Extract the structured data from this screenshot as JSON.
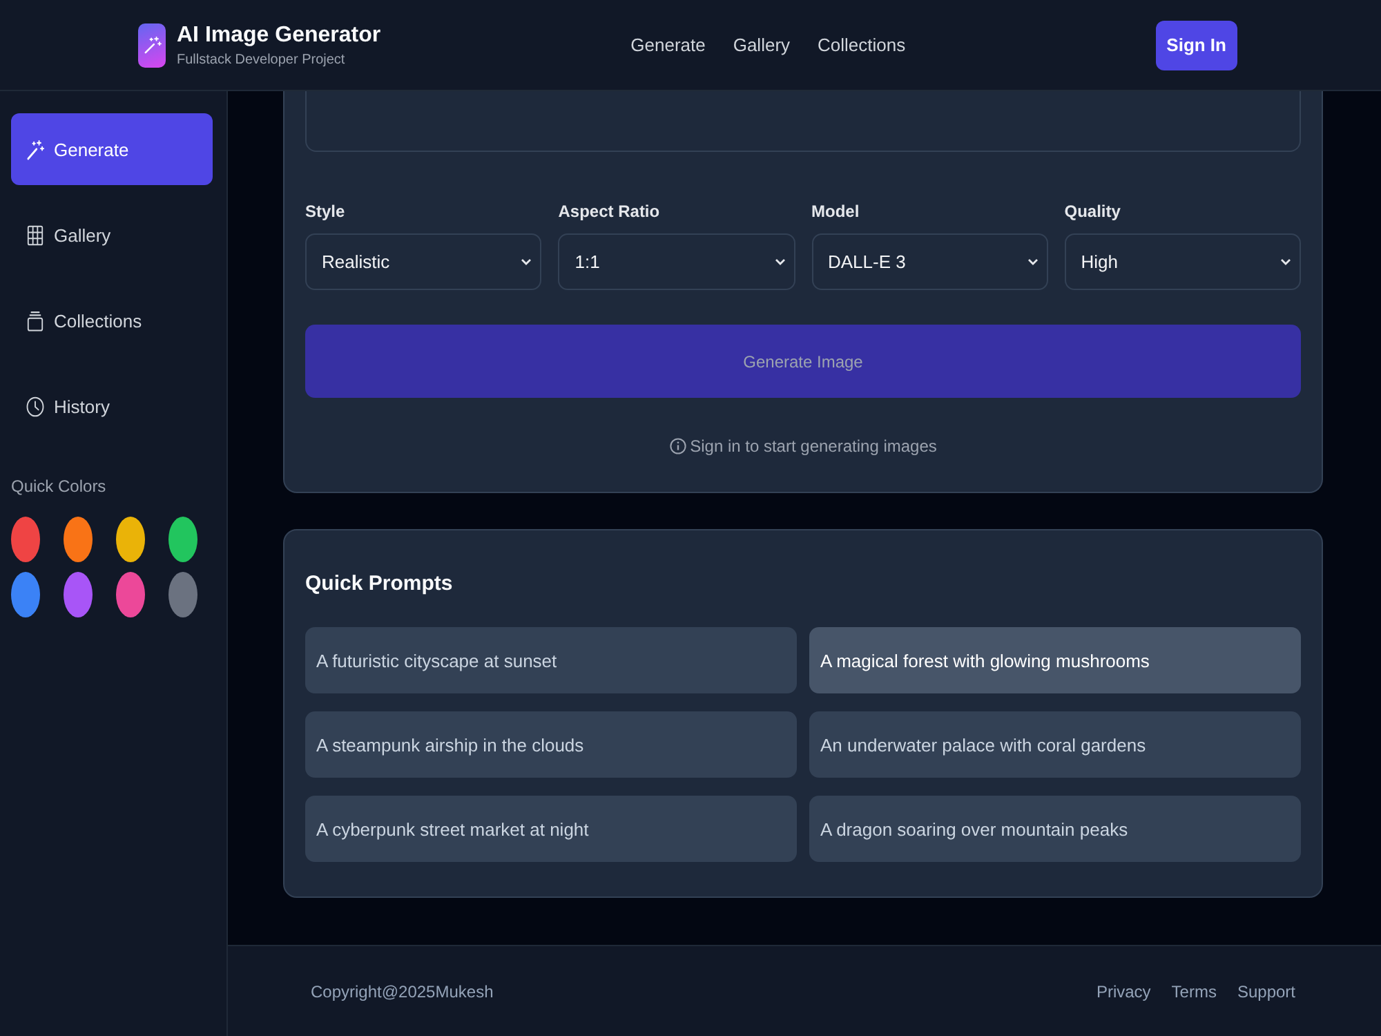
{
  "header": {
    "title": "AI Image Generator",
    "subtitle": "Fullstack Developer Project",
    "nav": [
      "Generate",
      "Gallery",
      "Collections"
    ],
    "sign_in": "Sign In"
  },
  "sidebar": {
    "items": [
      {
        "label": "Generate",
        "selected": true
      },
      {
        "label": "Gallery",
        "selected": false
      },
      {
        "label": "Collections",
        "selected": false
      },
      {
        "label": "History",
        "selected": false
      }
    ],
    "quick_colors": {
      "title": "Quick Colors",
      "swatches": [
        {
          "color": "#ef4444"
        },
        {
          "color": "#f97316"
        },
        {
          "color": "#eab308"
        },
        {
          "color": "#22c55e"
        },
        {
          "color": "#3b82f6"
        },
        {
          "color": "#a855f7"
        },
        {
          "color": "#ec4899"
        },
        {
          "color": "#6b7280"
        }
      ]
    }
  },
  "generator": {
    "options": [
      {
        "label": "Style",
        "value": "Realistic"
      },
      {
        "label": "Aspect Ratio",
        "value": "1:1"
      },
      {
        "label": "Model",
        "value": "DALL-E 3"
      },
      {
        "label": "Quality",
        "value": "High"
      }
    ],
    "generate_button": {
      "label": "Generate Image",
      "disabled": true
    },
    "notice": "Sign in to start generating images"
  },
  "quick_prompts": {
    "title": "Quick Prompts",
    "items": [
      {
        "text": "A futuristic cityscape at sunset",
        "highlighted": false
      },
      {
        "text": "A magical forest with glowing mushrooms",
        "highlighted": true
      },
      {
        "text": "A steampunk airship in the clouds",
        "highlighted": false
      },
      {
        "text": "An underwater palace with coral gardens",
        "highlighted": false
      },
      {
        "text": "A cyberpunk street market at night",
        "highlighted": false
      },
      {
        "text": "A dragon soaring over mountain peaks",
        "highlighted": false
      }
    ]
  },
  "footer": {
    "copyright": "Copyright@2025Mukesh",
    "links": [
      "Privacy",
      "Terms",
      "Support"
    ]
  }
}
